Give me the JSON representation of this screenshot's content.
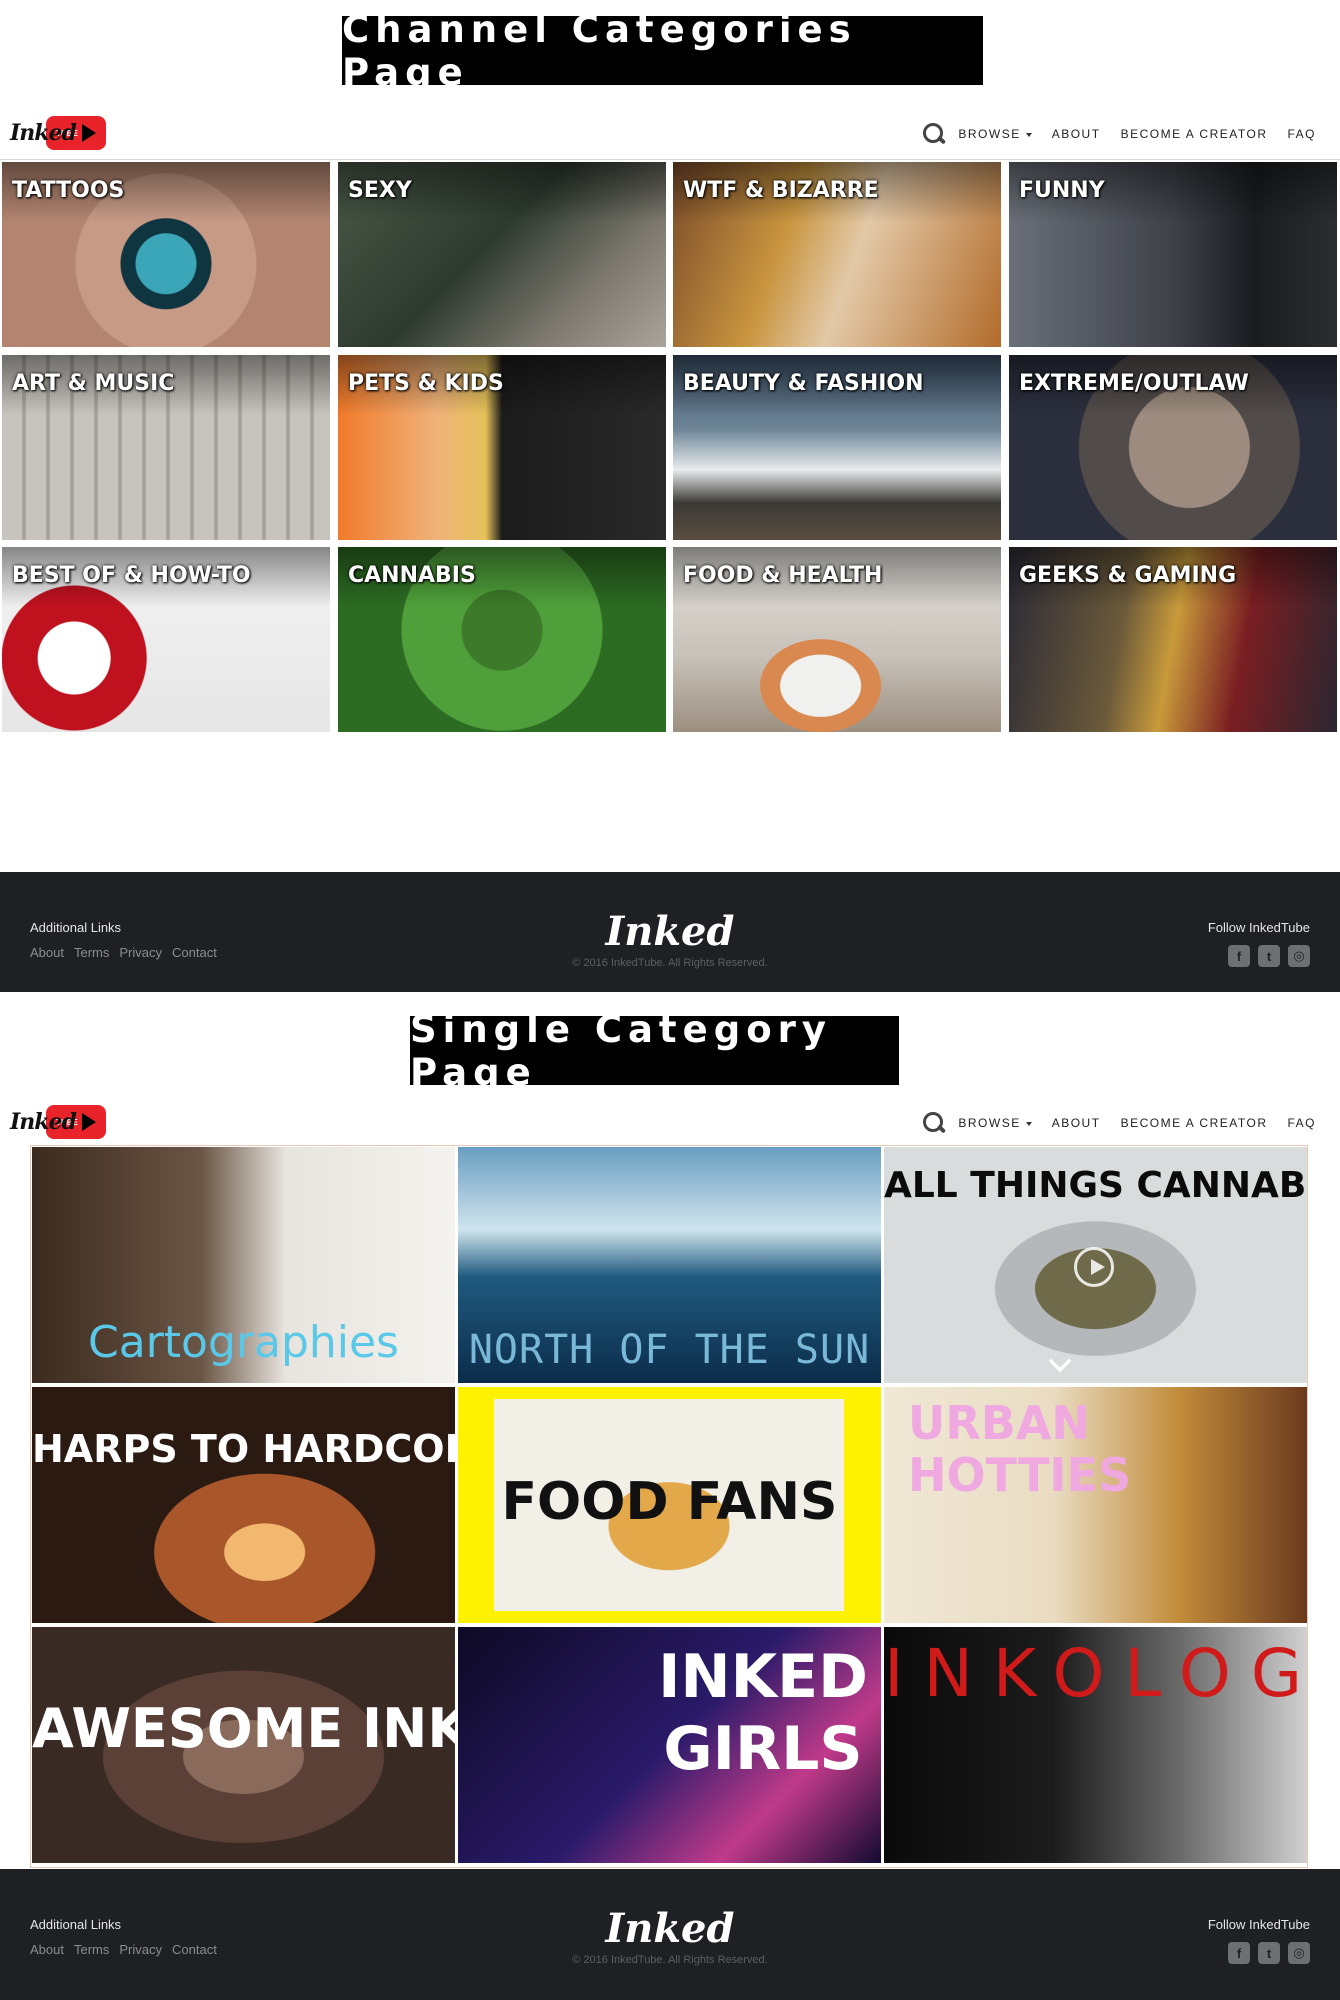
{
  "banners": {
    "top": "Channel Categories Page",
    "middle": "Single Category Page"
  },
  "brand": {
    "logo_text": "Inked",
    "logo_badge": "TUBE",
    "accent_color": "#e8232a"
  },
  "nav": {
    "browse": "BROWSE",
    "about": "ABOUT",
    "become_creator": "BECOME A CREATOR",
    "faq": "FAQ"
  },
  "categories": [
    {
      "label": "TATTOOS"
    },
    {
      "label": "SEXY"
    },
    {
      "label": "WTF & BIZARRE"
    },
    {
      "label": "FUNNY"
    },
    {
      "label": "ART & MUSIC"
    },
    {
      "label": "PETS & KIDS"
    },
    {
      "label": "BEAUTY & FASHION"
    },
    {
      "label": "EXTREME/OUTLAW"
    },
    {
      "label": "BEST OF & HOW-TO"
    },
    {
      "label": "CANNABIS"
    },
    {
      "label": "FOOD & HEALTH"
    },
    {
      "label": "GEEKS & GAMING"
    }
  ],
  "channels": [
    {
      "title": "Cartographies"
    },
    {
      "title": "NORTH OF THE SUN"
    },
    {
      "title": "ALL THINGS CANNABIS"
    },
    {
      "title": "HARPS TO HARDCORE"
    },
    {
      "title": "FOOD FANS"
    },
    {
      "title": "URBAN HOTTIES"
    },
    {
      "title": "AWESOME INK"
    },
    {
      "title": "INKED GIRLS"
    },
    {
      "title": "INKOLOGY"
    }
  ],
  "footer": {
    "heading": "Additional Links",
    "links": {
      "about": "About",
      "terms": "Terms",
      "privacy": "Privacy",
      "contact": "Contact"
    },
    "logo": "Inked",
    "copyright": "© 2016 InkedTube. All Rights Reserved.",
    "follow": "Follow InkedTube",
    "icons": [
      "facebook-icon",
      "twitter-icon",
      "instagram-icon"
    ]
  }
}
